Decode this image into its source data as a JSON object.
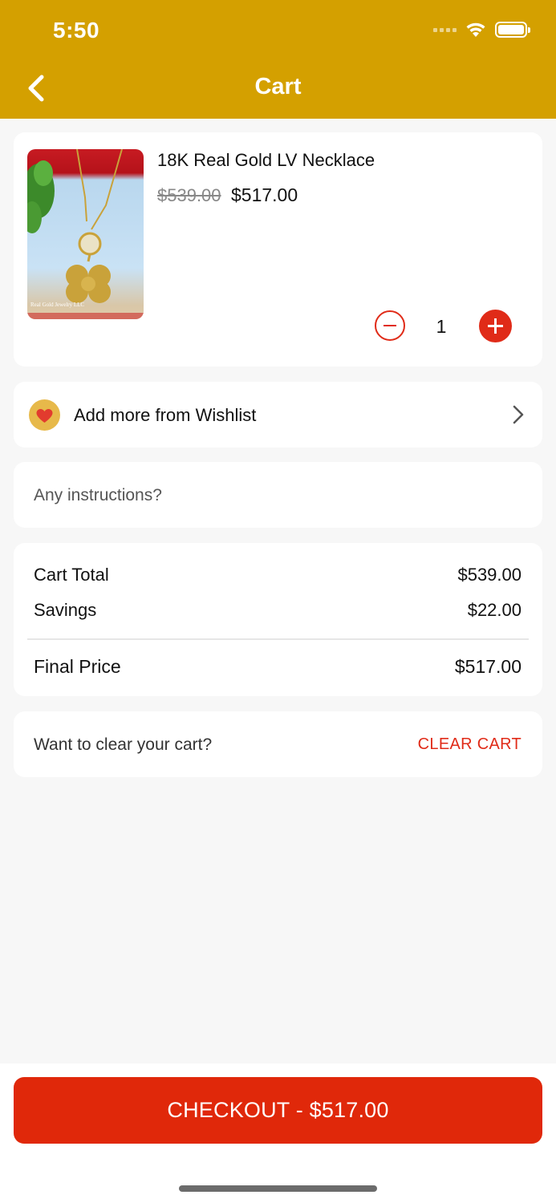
{
  "status_bar": {
    "time": "5:50"
  },
  "header": {
    "title": "Cart"
  },
  "cart_item": {
    "name": "18K Real Gold LV Necklace",
    "original_price": "$539.00",
    "price": "$517.00",
    "quantity": "1",
    "image_watermark": "Real Gold Jewelry LLC"
  },
  "wishlist": {
    "label": "Add more from Wishlist"
  },
  "instructions": {
    "placeholder": "Any instructions?"
  },
  "totals": {
    "cart_total_label": "Cart Total",
    "cart_total_value": "$539.00",
    "savings_label": "Savings",
    "savings_value": "$22.00",
    "final_label": "Final Price",
    "final_value": "$517.00"
  },
  "clear": {
    "prompt": "Want to clear your cart?",
    "button_label": "CLEAR CART"
  },
  "checkout": {
    "label": "CHECKOUT - $517.00"
  },
  "colors": {
    "header": "#d4a000",
    "accent": "#e02b18",
    "checkout": "#e0280a"
  },
  "icons": [
    "back-arrow-icon",
    "wifi-icon",
    "battery-icon",
    "minus-icon",
    "plus-icon",
    "heart-icon",
    "chevron-right-icon"
  ]
}
